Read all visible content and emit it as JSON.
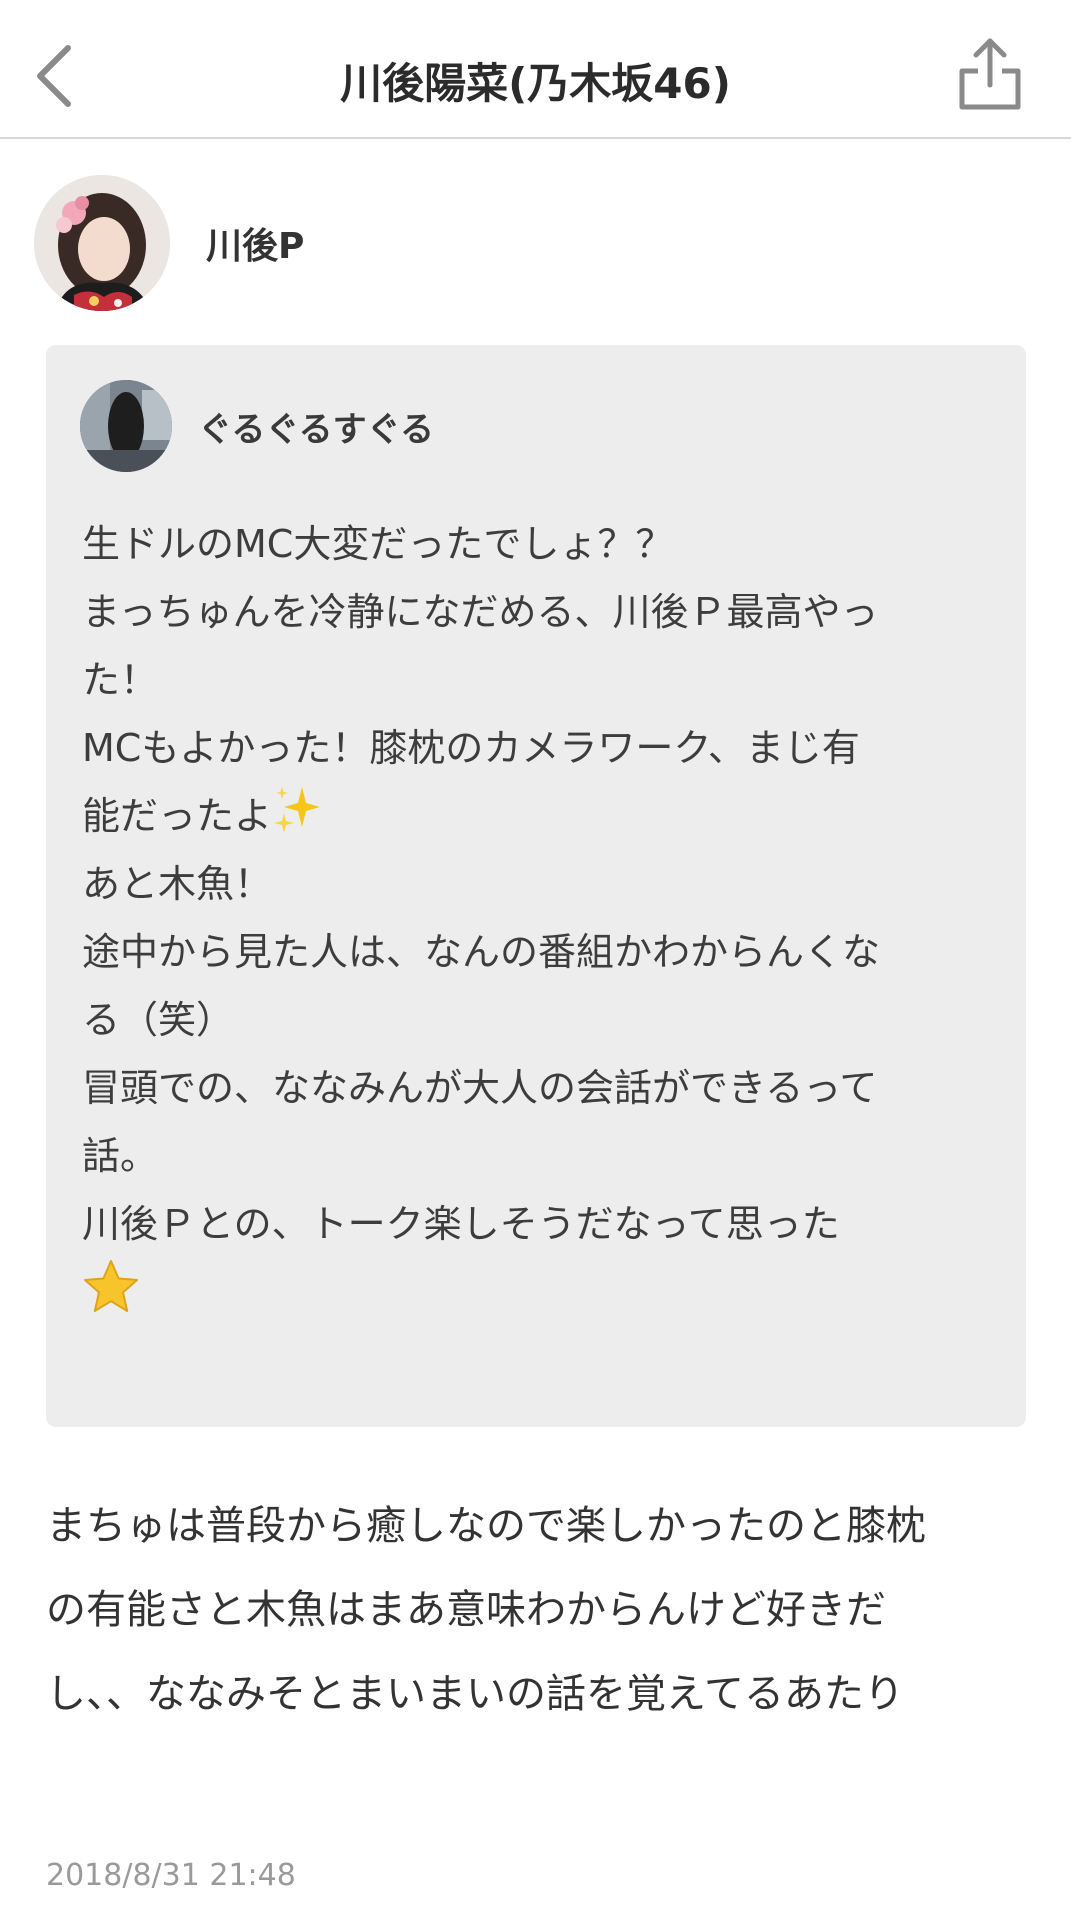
{
  "header": {
    "title": "川後陽菜(乃木坂46)",
    "back_icon": "chevron-left-icon",
    "share_icon": "share-icon"
  },
  "post": {
    "author_name": "川後P",
    "quote": {
      "author_name": "ぐるぐるすぐる",
      "lines": [
        "生ドルのMC大変だったでしょ？？",
        "まっちゅんを冷静になだめる、川後Ｐ最高やっ",
        "た！",
        "MCもよかった！膝枕のカメラワーク、まじ有",
        "能だったよ",
        "あと木魚！",
        "途中から見た人は、なんの番組かわからんくな",
        "る（笑）",
        "冒頭での、ななみんが大人の会話ができるって",
        "話。",
        "川後Ｐとの、トーク楽しそうだなって思った"
      ],
      "sparkle_icon": "sparkles-icon",
      "star_icon": "star-icon"
    },
    "reply_lines": [
      "まちゅは普段から癒しなので楽しかったのと膝枕",
      "の有能さと木魚はまあ意味わからんけど好きだ",
      "し、、ななみそとまいまいの話を覚えてるあたり"
    ],
    "timestamp": "2018/8/31 21:48"
  },
  "colors": {
    "quote_background": "#ededed",
    "timestamp": "#9a9a9a",
    "header_divider": "#d9d9d9"
  }
}
